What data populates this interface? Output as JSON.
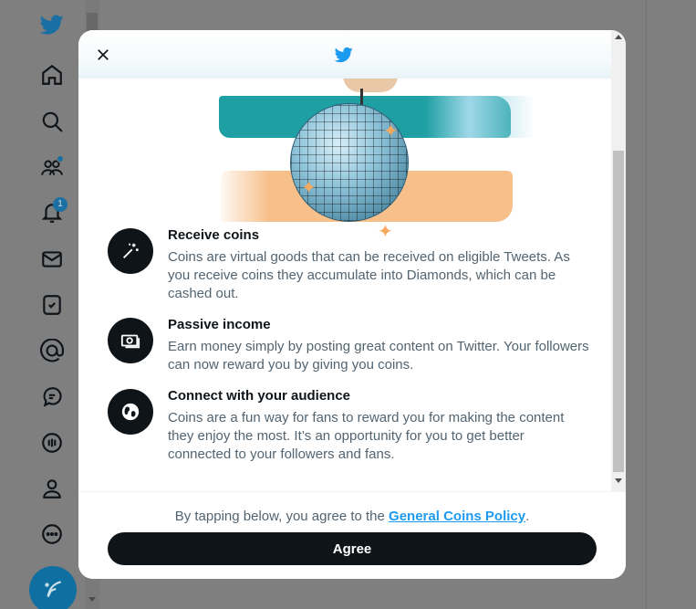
{
  "nav": {
    "icons": [
      "twitter-logo-icon",
      "home-icon",
      "explore-icon",
      "communities-icon",
      "notifications-icon",
      "messages-icon",
      "lists-icon",
      "topics-icon",
      "spaces-icon",
      "voice-icon",
      "profile-icon",
      "more-icon"
    ],
    "notifications_badge": "1",
    "compose_icon": "compose-icon"
  },
  "modal": {
    "header_logo": "twitter-logo-icon",
    "close_icon": "close-icon",
    "features": [
      {
        "icon": "sparkle-wand-icon",
        "title": "Receive coins",
        "body": "Coins are virtual goods that can be received on eligible Tweets. As you receive coins they accumulate into Diamonds, which can be cashed out."
      },
      {
        "icon": "money-icon",
        "title": "Passive income",
        "body": "Earn money simply by posting great content on Twitter. Your followers can now reward you by giving you coins."
      },
      {
        "icon": "globe-icon",
        "title": "Connect with your audience",
        "body": "Coins are a fun way for fans to reward you for making the content they enjoy the most. It’s an opportunity for you to get better connected to your followers and fans."
      }
    ],
    "footer": {
      "policy_prefix": "By tapping below, you agree to the ",
      "policy_link": "General Coins Policy",
      "policy_suffix": ".",
      "agree_label": "Agree"
    }
  },
  "colors": {
    "accent": "#1d9bf0",
    "overlay": "#7f7f7f",
    "button": "#0f1419"
  }
}
